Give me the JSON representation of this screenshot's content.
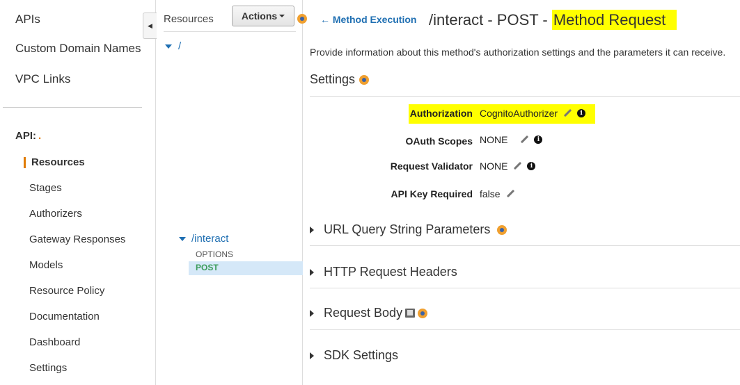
{
  "nav": {
    "top_items": [
      "APIs",
      "Custom Domain Names",
      "VPC Links"
    ],
    "api_label": "API:",
    "api_name": ".",
    "items": [
      "Resources",
      "Stages",
      "Authorizers",
      "Gateway Responses",
      "Models",
      "Resource Policy",
      "Documentation",
      "Dashboard",
      "Settings"
    ],
    "active": "Resources"
  },
  "resources_panel": {
    "title": "Resources",
    "actions_label": "Actions",
    "root": "/",
    "resource": "/interact",
    "methods": [
      "OPTIONS",
      "POST"
    ],
    "selected_method": "POST"
  },
  "main": {
    "back_link": "Method Execution",
    "title_prefix": "/interact - POST - ",
    "title_highlight": "Method Request",
    "description": "Provide information about this method's authorization settings and the parameters it can receive.",
    "settings_title": "Settings",
    "fields": {
      "authorization": {
        "label": "Authorization",
        "value": "CognitoAuthorizer"
      },
      "oauth": {
        "label": "OAuth Scopes",
        "value": "NONE"
      },
      "validator": {
        "label": "Request Validator",
        "value": "NONE"
      },
      "apikey": {
        "label": "API Key Required",
        "value": "false"
      }
    },
    "sections": {
      "query": "URL Query String Parameters",
      "headers": "HTTP Request Headers",
      "body": "Request Body",
      "sdk": "SDK Settings"
    }
  },
  "colors": {
    "link": "#1f6fb2",
    "accent": "#e07b00",
    "highlight": "#ffff00",
    "post_method": "#3c9c5a"
  }
}
